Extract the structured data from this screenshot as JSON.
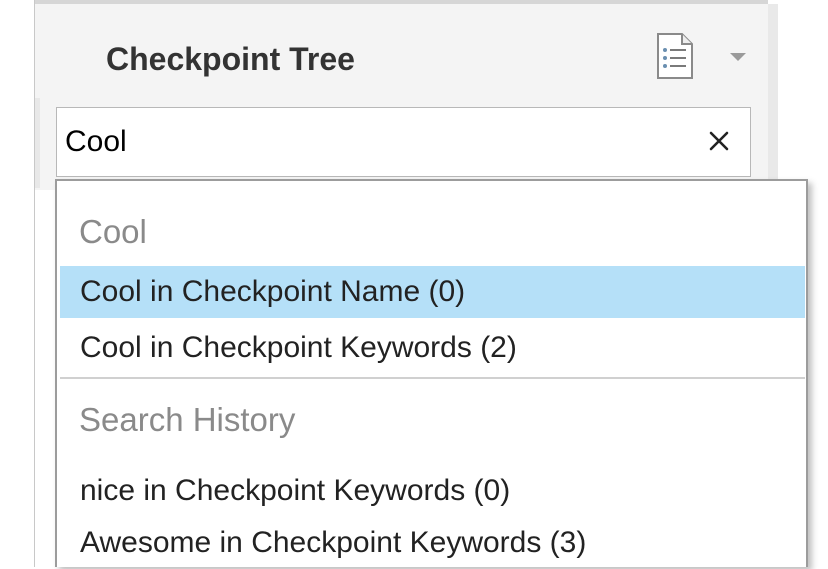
{
  "panel": {
    "title": "Checkpoint Tree",
    "icons": [
      "document-list-icon",
      "chevron-down-icon"
    ]
  },
  "search": {
    "value": "Cool",
    "clear_icon": "close-icon"
  },
  "dropdown": {
    "suggestion_group": {
      "header": "Cool",
      "items": [
        {
          "label": "Cool in Checkpoint Name (0)",
          "selected": true
        },
        {
          "label": "Cool in Checkpoint Keywords (2)",
          "selected": false
        }
      ]
    },
    "history_group": {
      "header": "Search History",
      "items": [
        {
          "label": "nice in Checkpoint Keywords (0)"
        },
        {
          "label": "Awesome in Checkpoint Keywords (3)"
        }
      ]
    }
  },
  "colors": {
    "selected_bg": "#b5e0f8",
    "header_text": "#8a8a8a"
  }
}
